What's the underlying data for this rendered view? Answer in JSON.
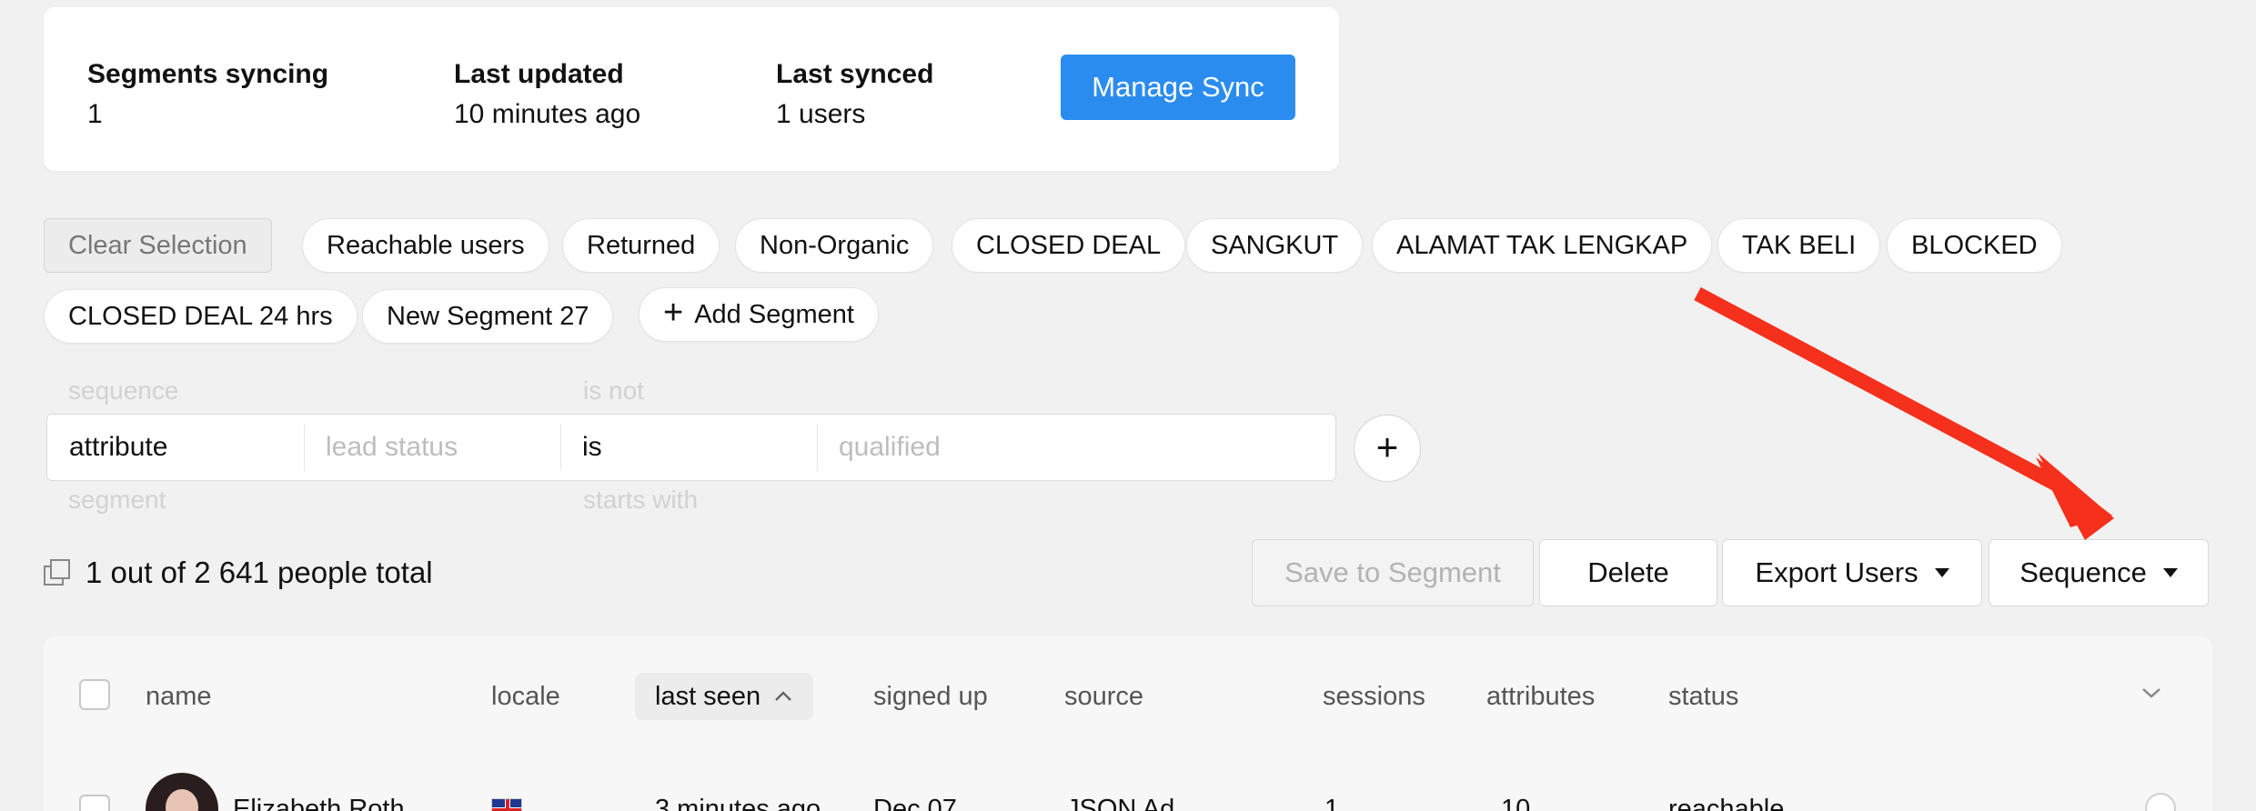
{
  "sync": {
    "segments_label": "Segments syncing",
    "segments_value": "1",
    "updated_label": "Last updated",
    "updated_value": "10 minutes ago",
    "synced_label": "Last synced",
    "synced_value": "1 users",
    "manage_label": "Manage Sync"
  },
  "segments": {
    "clear_label": "Clear Selection",
    "chips": [
      "Reachable users",
      "Returned",
      "Non-Organic",
      "CLOSED DEAL",
      "SANGKUT",
      "ALAMAT TAK LENGKAP",
      "TAK BELI",
      "BLOCKED",
      "CLOSED DEAL 24 hrs",
      "New Segment 27"
    ],
    "add_label": "Add Segment"
  },
  "filter": {
    "ghost_above_1": "sequence",
    "ghost_above_2": "is not",
    "ghost_below_1": "segment",
    "ghost_below_2": "starts with",
    "field": "attribute",
    "attribute_placeholder": "lead status",
    "operator": "is",
    "value_placeholder": "qualified"
  },
  "summary": {
    "count_text": "1 out of 2 641 people total",
    "save_label": "Save to Segment",
    "delete_label": "Delete",
    "export_label": "Export Users",
    "sequence_label": "Sequence"
  },
  "table": {
    "columns": {
      "name": "name",
      "locale": "locale",
      "last_seen": "last seen",
      "signed_up": "signed up",
      "source": "source",
      "sessions": "sessions",
      "attributes": "attributes",
      "status": "status"
    },
    "rows": [
      {
        "name": "Elizabeth Roth",
        "last_seen": "3 minutes ago",
        "signed_up": "Dec 07",
        "source": "JSON Ad",
        "sessions": "1",
        "attributes": "10",
        "status": "reachable"
      }
    ]
  },
  "colors": {
    "primary": "#2b8cf0",
    "arrow": "#f5301c",
    "background": "#f1f1f1"
  }
}
